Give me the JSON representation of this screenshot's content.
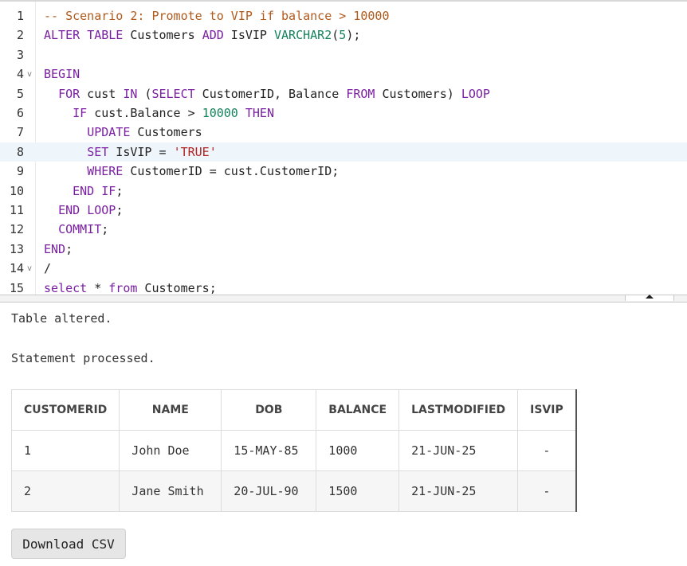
{
  "editor": {
    "lines": [
      {
        "n": "1",
        "code": "-- Scenario 2: Promote to VIP if balance > 10000"
      },
      {
        "n": "2",
        "code": "ALTER TABLE Customers ADD IsVIP VARCHAR2(5);"
      },
      {
        "n": "3",
        "code": ""
      },
      {
        "n": "4",
        "code": "BEGIN",
        "fold": true
      },
      {
        "n": "5",
        "code": "  FOR cust IN (SELECT CustomerID, Balance FROM Customers) LOOP"
      },
      {
        "n": "6",
        "code": "    IF cust.Balance > 10000 THEN"
      },
      {
        "n": "7",
        "code": "      UPDATE Customers"
      },
      {
        "n": "8",
        "code": "      SET IsVIP = 'TRUE'",
        "active": true
      },
      {
        "n": "9",
        "code": "      WHERE CustomerID = cust.CustomerID;"
      },
      {
        "n": "10",
        "code": "    END IF;"
      },
      {
        "n": "11",
        "code": "  END LOOP;"
      },
      {
        "n": "12",
        "code": "  COMMIT;"
      },
      {
        "n": "13",
        "code": "END;"
      },
      {
        "n": "14",
        "code": "/",
        "fold": true
      },
      {
        "n": "15",
        "code": "select * from Customers;"
      }
    ]
  },
  "output": {
    "msg1": "Table altered.",
    "msg2": "Statement processed."
  },
  "table": {
    "headers": [
      "CUSTOMERID",
      "NAME",
      "DOB",
      "BALANCE",
      "LASTMODIFIED",
      "ISVIP"
    ],
    "rows": [
      [
        "1",
        "John Doe",
        "15-MAY-85",
        "1000",
        "21-JUN-25",
        "-"
      ],
      [
        "2",
        "Jane Smith",
        "20-JUL-90",
        "1500",
        "21-JUN-25",
        "-"
      ]
    ]
  },
  "download_label": "Download CSV"
}
